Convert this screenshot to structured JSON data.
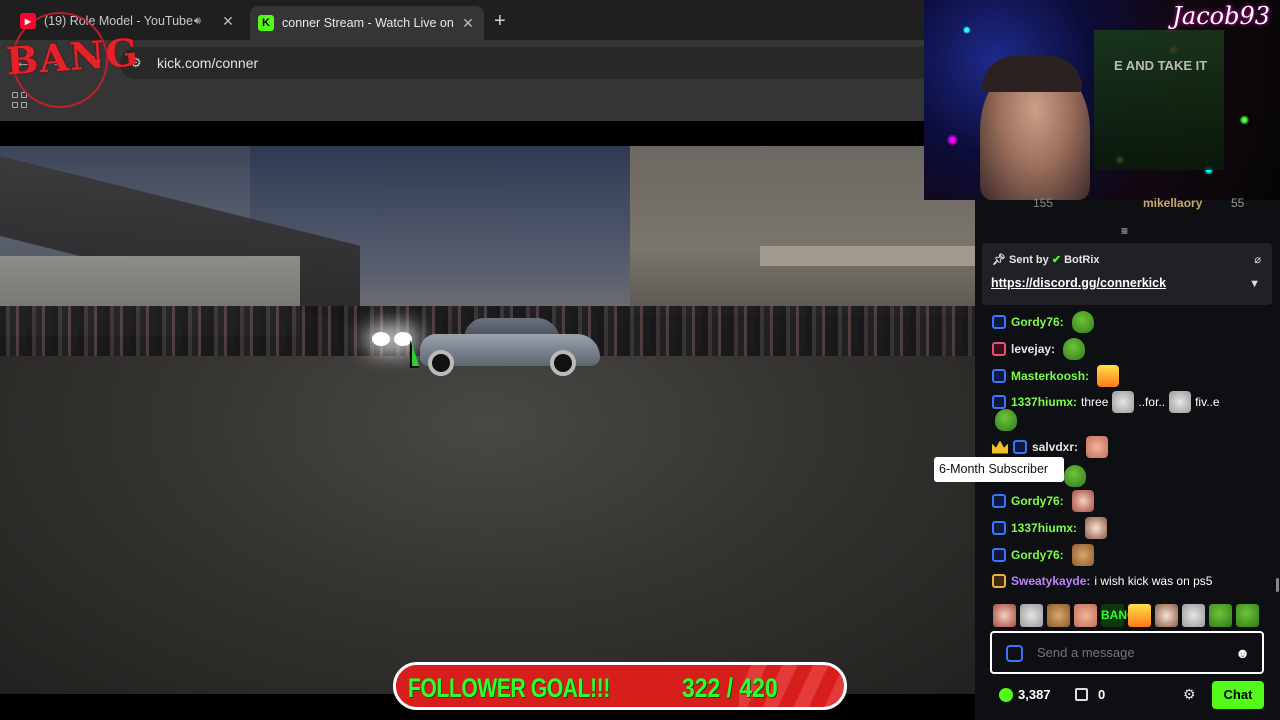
{
  "browser": {
    "tabs": [
      {
        "title": "(19) Role Model - YouTube",
        "favicon": "youtube-icon",
        "audio": true,
        "active": false
      },
      {
        "title": "conner Stream - Watch Live on",
        "favicon": "kick-icon",
        "active": true
      }
    ],
    "url": "kick.com/conner"
  },
  "overlay": {
    "logo_text": "BANG",
    "webcam_name": "Jacob93",
    "goal_label": "FOLLOWER GOAL!!!",
    "goal_count": "322 / 420",
    "goal_current": 322,
    "goal_target": 420
  },
  "chat": {
    "top_partial": {
      "count_left": "155",
      "user": "mikellaory",
      "count_right": "55"
    },
    "pinned": {
      "sent_by_label": "Sent by",
      "sender": "BotRix",
      "link": "https://discord.gg/connerkick"
    },
    "messages": [
      {
        "user": "Gordy76:",
        "text": "",
        "user_color": "#7CFC4A",
        "badge": "blue",
        "emote": "pepe"
      },
      {
        "user": "levejay:",
        "text": "",
        "user_color": "#E6E6E6",
        "badge": "pink",
        "emote": "pepe"
      },
      {
        "user": "Masterkoosh:",
        "text": "",
        "user_color": "#7CFC4A",
        "badge": "blue",
        "emote": "fire"
      },
      {
        "user": "1337hiumx:",
        "text": "three",
        "text2": "..for..",
        "text3": "fiv..e",
        "user_color": "#7CFC4A",
        "badge": "blue"
      },
      {
        "user": "salvdxr:",
        "text": "",
        "user_color": "#E6E6E6",
        "badge": "blue",
        "emote": "hand"
      },
      {
        "user": "Gordy76:",
        "text": "",
        "user_color": "#7CFC4A",
        "badge": "blue",
        "emote": "face"
      },
      {
        "user": "1337hiumx:",
        "text": "",
        "user_color": "#7CFC4A",
        "badge": "blue",
        "emote": "anime"
      },
      {
        "user": "Gordy76:",
        "text": "",
        "user_color": "#7CFC4A",
        "badge": "blue",
        "emote": "tabby"
      },
      {
        "user": "Sweatykayde:",
        "text": "i wish kick was on ps5",
        "user_color": "#C084FC",
        "badge": "gold"
      }
    ],
    "tooltip": "6-Month Subscriber",
    "emote_bar_text": "BANG",
    "input_placeholder": "Send a message",
    "viewers": "3,387",
    "store_count": "0",
    "chat_button": "Chat"
  },
  "colors": {
    "kick_green": "#53FC18",
    "goal_red": "#D81D1D",
    "goal_text": "#2DFF2D"
  }
}
